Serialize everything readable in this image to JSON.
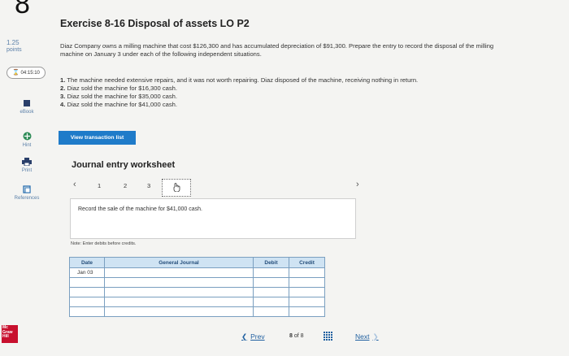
{
  "question_number": "8",
  "title": "Exercise 8-16 Disposal of assets LO P2",
  "points": {
    "value": "1.25",
    "label": "points"
  },
  "timer": "04:15:10",
  "sidebar": {
    "ebook": "eBook",
    "hint": "Hint",
    "print": "Print",
    "references": "References"
  },
  "description": "Diaz Company owns a milling machine that cost $126,300 and has accumulated depreciation of $91,300. Prepare the entry to record the disposal of the milling machine on January 3 under each of the following independent situations.",
  "situations": [
    {
      "num": "1.",
      "text": "The machine needed extensive repairs, and it was not worth repairing. Diaz disposed of the machine, receiving nothing in return."
    },
    {
      "num": "2.",
      "text": "Diaz sold the machine for $16,300 cash."
    },
    {
      "num": "3.",
      "text": "Diaz sold the machine for $35,000 cash."
    },
    {
      "num": "4.",
      "text": "Diaz sold the machine for $41,000 cash."
    }
  ],
  "view_transaction_button": "View transaction list",
  "worksheet": {
    "title": "Journal entry worksheet",
    "pages": [
      "1",
      "2",
      "3"
    ],
    "instruction": "Record the sale of the machine for $41,000 cash.",
    "note": "Note: Enter debits before credits.",
    "columns": {
      "date": "Date",
      "account": "General Journal",
      "debit": "Debit",
      "credit": "Credit"
    },
    "rows": [
      {
        "date": "Jan 03",
        "account": "",
        "debit": "",
        "credit": ""
      },
      {
        "date": "",
        "account": "",
        "debit": "",
        "credit": ""
      },
      {
        "date": "",
        "account": "",
        "debit": "",
        "credit": ""
      },
      {
        "date": "",
        "account": "",
        "debit": "",
        "credit": ""
      },
      {
        "date": "",
        "account": "",
        "debit": "",
        "credit": ""
      }
    ]
  },
  "footer": {
    "prev": "Prev",
    "current_page": "8",
    "of": "of",
    "total_pages": "8",
    "next": "Next"
  },
  "logo_text": [
    "Mc",
    "Graw",
    "Hill"
  ],
  "colors": {
    "accent": "#1f7bc9",
    "link": "#1f5fa0",
    "table_header": "#cfe3f3",
    "logo": "#c8102e"
  }
}
